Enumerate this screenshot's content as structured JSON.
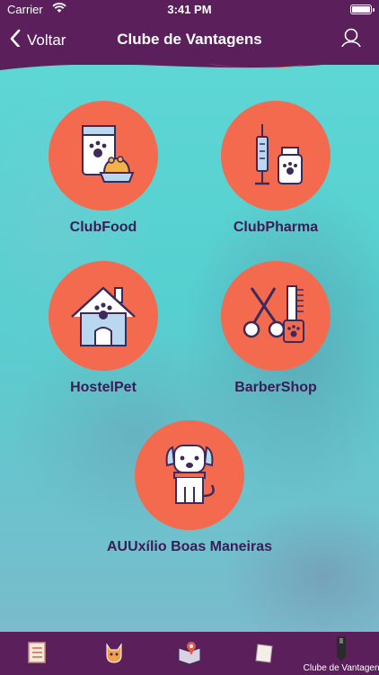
{
  "status": {
    "carrier": "Carrier",
    "time": "3:41 PM",
    "battery_level": 1.0
  },
  "navbar": {
    "back_label": "Voltar",
    "title": "Clube de Vantagens",
    "back_icon": "chevron-left-icon",
    "profile_icon": "user-icon"
  },
  "colors": {
    "bar": "#5b1f5c",
    "tile": "#f36a4f",
    "label": "#3c1c58",
    "background": "#5ad6d4"
  },
  "tiles": [
    {
      "label": "ClubFood",
      "icon": "pet-food-icon"
    },
    {
      "label": "ClubPharma",
      "icon": "pet-medicine-icon"
    },
    {
      "label": "HostelPet",
      "icon": "pet-house-icon"
    },
    {
      "label": "BarberShop",
      "icon": "grooming-scissors-icon"
    },
    {
      "label": "AUUxílio Boas Maneiras",
      "icon": "dog-training-icon"
    }
  ],
  "tabs": [
    {
      "label": "",
      "icon": "checklist-icon",
      "selected": false
    },
    {
      "label": "",
      "icon": "cat-icon",
      "selected": false
    },
    {
      "label": "",
      "icon": "map-book-icon",
      "selected": false
    },
    {
      "label": "",
      "icon": "note-icon",
      "selected": false
    },
    {
      "label": "Clube de Vantagens",
      "icon": "membership-icon",
      "selected": true
    }
  ]
}
